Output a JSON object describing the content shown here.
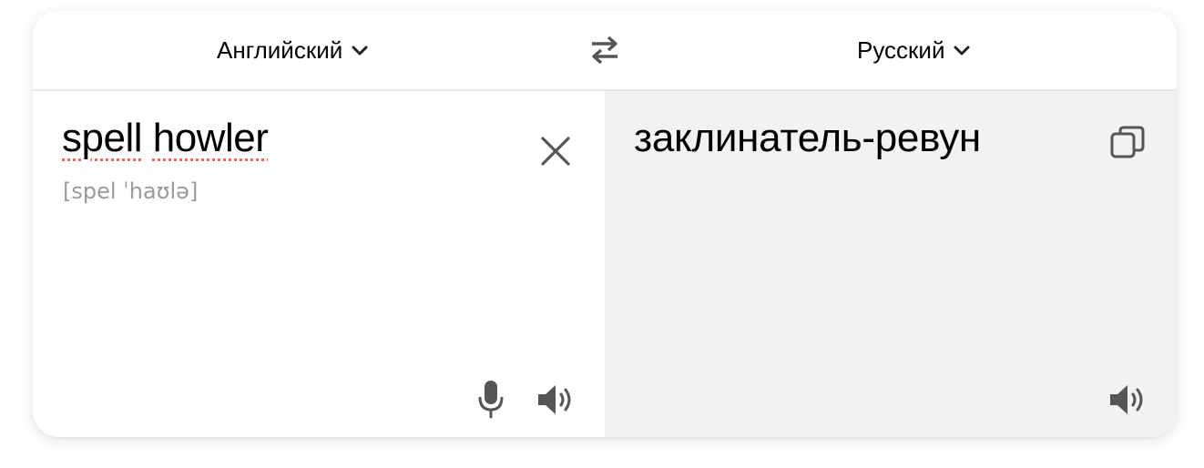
{
  "header": {
    "source_language": "Английский",
    "target_language": "Русский",
    "swap_icon": "swap-arrows-icon",
    "dropdown_icon": "chevron-down-icon"
  },
  "source": {
    "text_word1": "spell",
    "text_word2": "howler",
    "transcription": "[spel ˈhaʊlə]",
    "clear_icon": "close-icon",
    "mic_icon": "microphone-icon",
    "speaker_icon": "speaker-icon"
  },
  "translation": {
    "text": "заклинатель-ревун",
    "copy_icon": "copy-icon",
    "speaker_icon": "speaker-icon"
  },
  "colors": {
    "spellcheck_underline": "#e8685a",
    "icon": "#555555",
    "translation_bg": "#f2f2f2"
  }
}
